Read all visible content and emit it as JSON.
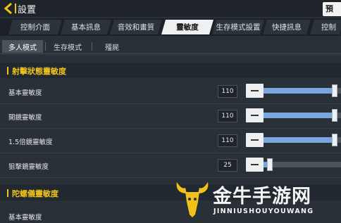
{
  "header": {
    "title": "設置",
    "right_button_label": "預"
  },
  "main_tabs": [
    {
      "label": "控制介面"
    },
    {
      "label": "基本訊息"
    },
    {
      "label": "音效和畫質"
    },
    {
      "label": "靈敏度",
      "active": true
    },
    {
      "label": "生存模式設置"
    },
    {
      "label": "快捷訊息"
    },
    {
      "label": "控制"
    }
  ],
  "sub_tabs": [
    {
      "label": "多人模式",
      "active": true
    },
    {
      "label": "生存模式"
    },
    {
      "label": "殭屍"
    }
  ],
  "sections": [
    {
      "title": "射擊狀態靈敏度",
      "rows": [
        {
          "label": "基本靈敏度",
          "value": "110",
          "fraction": 0.92
        },
        {
          "label": "開鏡靈敏度",
          "value": "110",
          "fraction": 0.92
        },
        {
          "label": "1.5倍鏡靈敏度",
          "value": "110",
          "fraction": 0.92
        },
        {
          "label": "狙擊鏡靈敏度",
          "value": "25",
          "fraction": 0.08
        }
      ]
    },
    {
      "title": "陀螺儀靈敏度",
      "rows": [
        {
          "label": "基本靈敏度",
          "value": "",
          "fraction": 0.0
        }
      ]
    }
  ],
  "watermark": {
    "chinese": "金牛手游网",
    "english": "JINNIUSHOUYOUWANG"
  },
  "colors": {
    "accent": "#f0c419",
    "slider_fill": "#7aa7e0",
    "background": "#2a3038"
  }
}
